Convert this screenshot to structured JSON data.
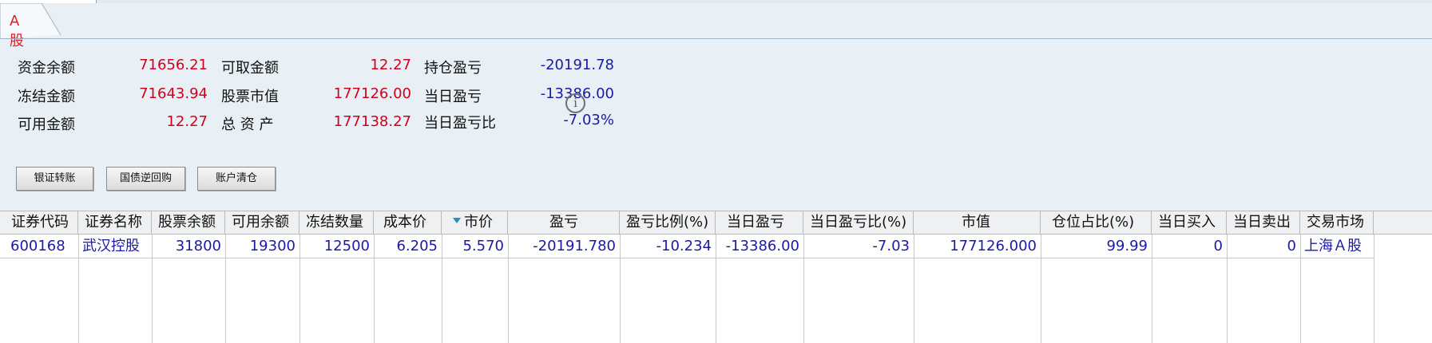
{
  "tab": {
    "label": "A股"
  },
  "summary": {
    "col1": [
      {
        "label": "资金余额",
        "value": "71656.21"
      },
      {
        "label": "冻结金额",
        "value": "71643.94"
      },
      {
        "label": "可用金额",
        "value": "12.27"
      }
    ],
    "col2": [
      {
        "label": "可取金额",
        "value": "12.27"
      },
      {
        "label": "股票市值",
        "value": "177126.00"
      },
      {
        "label": "总 资 产",
        "value": "177138.27"
      }
    ],
    "col3": [
      {
        "label": "持仓盈亏",
        "value": "-20191.78"
      },
      {
        "label": "当日盈亏",
        "value": "-13386.00"
      },
      {
        "label": "当日盈亏比",
        "value": "-7.03%"
      }
    ],
    "info_glyph": "i",
    "value_colors": {
      "positive": "#d0011b",
      "negative": "#1a1aa6"
    }
  },
  "buttons": {
    "bank_transfer": "银证转账",
    "repo": "国债逆回购",
    "clear_position": "账户清仓"
  },
  "table": {
    "headers": [
      "证券代码",
      "证券名称",
      "股票余额",
      "可用余额",
      "冻结数量",
      "成本价",
      "市价",
      "盈亏",
      "盈亏比例(%)",
      "当日盈亏",
      "当日盈亏比(%)",
      "市值",
      "仓位占比(%)",
      "当日买入",
      "当日卖出",
      "交易市场"
    ],
    "sorted_column": "市价",
    "rows": [
      [
        "600168",
        "武汉控股",
        "31800",
        "19300",
        "12500",
        "6.205",
        "5.570",
        "-20191.780",
        "-10.234",
        "-13386.00",
        "-7.03",
        "177126.000",
        "99.99",
        "0",
        "0",
        "上海Ａ股"
      ]
    ]
  }
}
